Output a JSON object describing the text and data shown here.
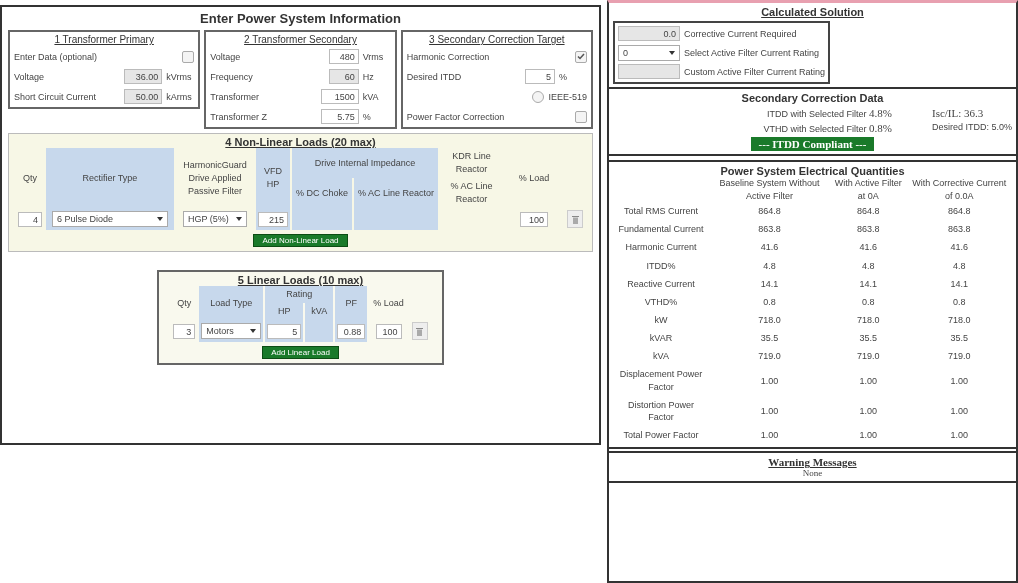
{
  "input_panel": {
    "title": "Enter Power System Information",
    "sections": [
      {
        "title": "1 Transformer Primary",
        "rows": [
          {
            "kind": "checkbox",
            "label": "Enter Data (optional)",
            "checked": false
          },
          {
            "kind": "field",
            "label": "Voltage",
            "value": "36.00",
            "unit": "kVrms",
            "disabled": true
          },
          {
            "kind": "field",
            "label": "Short Circuit Current",
            "value": "50.00",
            "unit": "kArms",
            "disabled": true
          }
        ]
      },
      {
        "title": "2 Transformer Secondary",
        "rows": [
          {
            "kind": "field",
            "label": "Voltage",
            "value": "480",
            "unit": "Vrms",
            "disabled": false
          },
          {
            "kind": "field",
            "label": "Frequency",
            "value": "60",
            "unit": "Hz",
            "disabled": true
          },
          {
            "kind": "field",
            "label": "Transformer",
            "value": "1500",
            "unit": "kVA",
            "disabled": false
          },
          {
            "kind": "field",
            "label": "Transformer Z",
            "value": "5.75",
            "unit": "%",
            "disabled": false
          }
        ]
      },
      {
        "title": "3 Secondary Correction Target",
        "rows": [
          {
            "kind": "checkbox",
            "label": "Harmonic Correction",
            "checked": true
          },
          {
            "kind": "field",
            "label": "Desired ITDD",
            "value": "5",
            "unit": "%",
            "disabled": false
          },
          {
            "kind": "radio",
            "label": "IEEE-519",
            "checked": false
          },
          {
            "kind": "checkbox",
            "label": "Power Factor Correction",
            "checked": false
          }
        ]
      }
    ],
    "nonlinear": {
      "title": "4 Non-Linear Loads (20 max)",
      "headers": {
        "qty": "Qty",
        "rectifier": "Rectifier Type",
        "filter": "HarmonicGuard Drive Applied Passive Filter",
        "hp": "VFD HP",
        "impedance": "Drive Internal Impedance",
        "dc_choke": "% DC Choke",
        "ac_reactor": "% AC Line Reactor",
        "kdr": "KDR Line Reactor",
        "kdr_sub": "% AC Line Reactor",
        "load": "% Load"
      },
      "rows": [
        {
          "qty": "4",
          "rectifier": "6 Pulse Diode",
          "filter": "HGP (5%)",
          "hp": "215",
          "load": "100"
        }
      ],
      "add_button": "Add Non-Linear Load"
    },
    "linear": {
      "title": "5 Linear Loads (10 max)",
      "headers": {
        "qty": "Qty",
        "type": "Load Type",
        "rating": "Rating",
        "hp": "HP",
        "kva": "kVA",
        "pf": "PF",
        "load": "% Load"
      },
      "rows": [
        {
          "qty": "3",
          "type": "Motors",
          "hp": "5",
          "pf": "0.88",
          "load": "100"
        }
      ],
      "add_button": "Add Linear Load"
    }
  },
  "solution": {
    "title": "Calculated Solution",
    "rows": [
      {
        "kind": "output",
        "value": "0.0",
        "label": "Corrective Current Required"
      },
      {
        "kind": "select",
        "value": "0",
        "label": "Select Active Filter Current Rating"
      },
      {
        "kind": "output",
        "value": "",
        "label": "Custom Active Filter Current Rating"
      }
    ]
  },
  "correction": {
    "title": "Secondary Correction Data",
    "itdd": "ITDD with Selected Filter",
    "itdd_value": "4.8%",
    "isc": "Isc/IL: 36.3",
    "vthd": "VTHD with Selected Filter",
    "vthd_value": "0.8%",
    "desired": "Desired ITDD: 5.0%",
    "status": "--- ITDD Compliant ---"
  },
  "quantities": {
    "title": "Power System Electrical Quantities",
    "columns": [
      "Baseline System Without Active Filter",
      "With Active Filter at 0A",
      "With Corrective Current of 0.0A"
    ],
    "rows": [
      {
        "label": "Total RMS Current",
        "values": [
          "864.8",
          "864.8",
          "864.8"
        ]
      },
      {
        "label": "Fundamental Current",
        "values": [
          "863.8",
          "863.8",
          "863.8"
        ]
      },
      {
        "label": "Harmonic Current",
        "values": [
          "41.6",
          "41.6",
          "41.6"
        ]
      },
      {
        "label": "ITDD%",
        "values": [
          "4.8",
          "4.8",
          "4.8"
        ]
      },
      {
        "label": "Reactive Current",
        "values": [
          "14.1",
          "14.1",
          "14.1"
        ]
      },
      {
        "label": "VTHD%",
        "values": [
          "0.8",
          "0.8",
          "0.8"
        ]
      },
      {
        "label": "kW",
        "values": [
          "718.0",
          "718.0",
          "718.0"
        ]
      },
      {
        "label": "kVAR",
        "values": [
          "35.5",
          "35.5",
          "35.5"
        ]
      },
      {
        "label": "kVA",
        "values": [
          "719.0",
          "719.0",
          "719.0"
        ]
      },
      {
        "label": "Displacement Power Factor",
        "values": [
          "1.00",
          "1.00",
          "1.00"
        ]
      },
      {
        "label": "Distortion Power Factor",
        "values": [
          "1.00",
          "1.00",
          "1.00"
        ]
      },
      {
        "label": "Total Power Factor",
        "values": [
          "1.00",
          "1.00",
          "1.00"
        ]
      }
    ]
  },
  "warnings": {
    "title": "Warning Messages",
    "text": "None"
  }
}
